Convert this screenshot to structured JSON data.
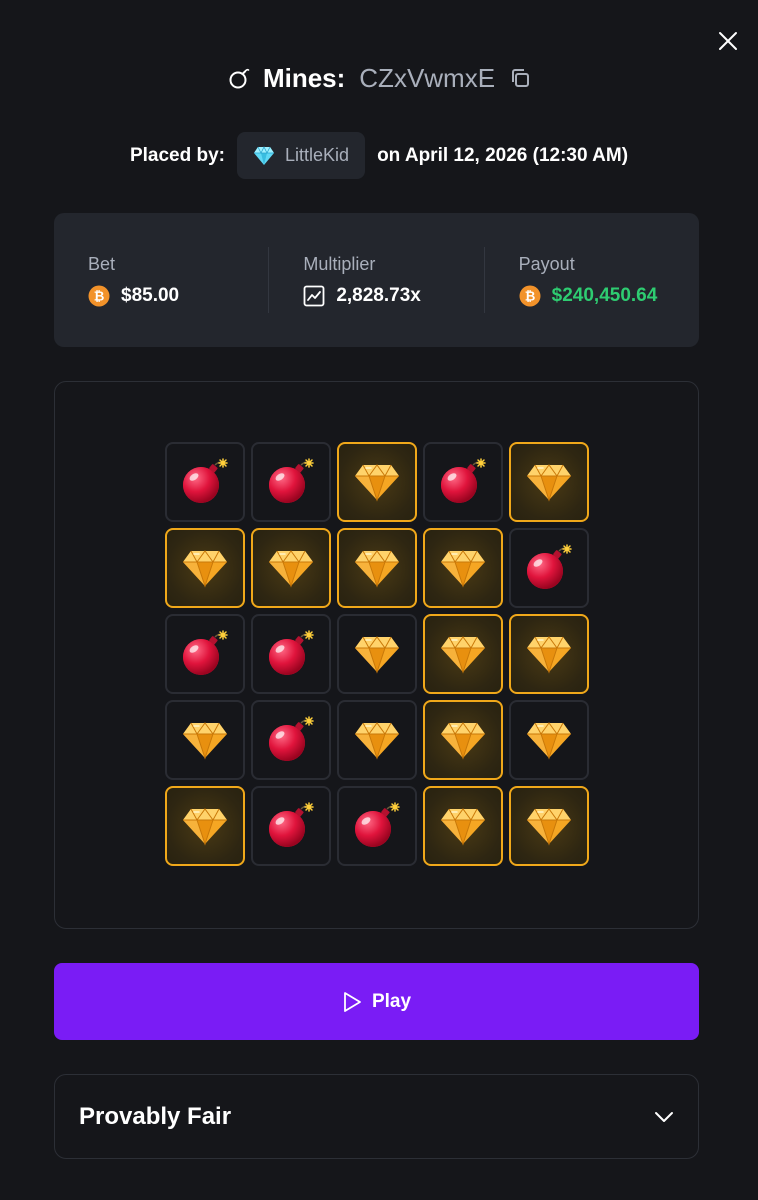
{
  "header": {
    "title": "Mines:",
    "game_id": "CZxVwmxE",
    "icons": {
      "close": "close-icon",
      "title": "bomb-icon",
      "copy": "copy-icon"
    }
  },
  "placed": {
    "prefix": "Placed by:",
    "username": "LittleKid",
    "user_icon": "diamond-icon",
    "date_text": "on April 12, 2026 (12:30 AM)"
  },
  "stats": {
    "bet": {
      "label": "Bet",
      "value": "$85.00",
      "icon": "bitcoin-icon"
    },
    "multiplier": {
      "label": "Multiplier",
      "value": "2,828.73x",
      "icon": "chart-icon"
    },
    "payout": {
      "label": "Payout",
      "value": "$240,450.64",
      "icon": "bitcoin-icon"
    }
  },
  "board": {
    "rows": [
      [
        "mine",
        "mine",
        "gem-revealed",
        "mine",
        "gem-revealed"
      ],
      [
        "gem-revealed",
        "gem-revealed",
        "gem-revealed",
        "gem-revealed",
        "mine"
      ],
      [
        "mine",
        "mine",
        "gem",
        "gem-revealed",
        "gem-revealed"
      ],
      [
        "gem",
        "mine",
        "gem",
        "gem-revealed",
        "gem"
      ],
      [
        "gem-revealed",
        "mine",
        "mine",
        "gem-revealed",
        "gem-revealed"
      ]
    ]
  },
  "actions": {
    "play_label": "Play",
    "play_icon": "play-icon"
  },
  "fair": {
    "title": "Provably Fair",
    "icon": "chevron-down-icon"
  },
  "colors": {
    "background": "#15161a",
    "card": "#23262d",
    "accent": "#7a1cf5",
    "payout": "#2ecc71",
    "gem_border": "#f0a81a",
    "muted_text": "#a9afbb"
  }
}
